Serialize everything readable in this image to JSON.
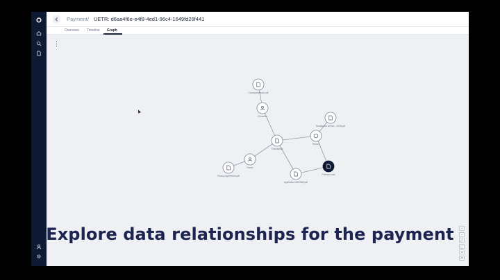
{
  "sidebar": {
    "items": [
      {
        "icon": "logo-icon"
      },
      {
        "icon": "home-icon"
      },
      {
        "icon": "search-icon"
      },
      {
        "icon": "document-icon"
      }
    ],
    "bottom_items": [
      {
        "icon": "user-icon"
      },
      {
        "icon": "gear-icon"
      }
    ]
  },
  "header": {
    "back_icon": "chevron-left-icon",
    "breadcrumb_parent": "Payment",
    "breadcrumb_separator": "/",
    "breadcrumb_current": "UETR: d6aa4f6e-e4f8-4ed1-96c4-1649fd26f441"
  },
  "tabs": [
    {
      "label": "Overview",
      "active": false
    },
    {
      "label": "Timeline",
      "active": false
    },
    {
      "label": "Graph",
      "active": true
    }
  ],
  "toolbar": {
    "more_icon": "⋮"
  },
  "graph": {
    "nodes": [
      {
        "id": "n1",
        "type": "document",
        "label": "Correspondence.pdf",
        "dark": false
      },
      {
        "id": "n2",
        "type": "person",
        "label": "Customer",
        "dark": false
      },
      {
        "id": "n3",
        "type": "document",
        "label": "Remittance advice – 2018.pdf",
        "dark": false
      },
      {
        "id": "n4",
        "type": "package",
        "label": "Record",
        "dark": false
      },
      {
        "id": "n5",
        "type": "document",
        "label": "Transaction",
        "dark": false
      },
      {
        "id": "n6",
        "type": "person",
        "label": "Owner",
        "dark": false
      },
      {
        "id": "n7",
        "type": "document",
        "label": "Privacy Agreement.pdf",
        "dark": false
      },
      {
        "id": "n8",
        "type": "document",
        "label": "Application 2827883.pdf",
        "dark": false
      },
      {
        "id": "n9",
        "type": "document",
        "label": "Primary node",
        "dark": true
      }
    ],
    "edges": [
      [
        "n1",
        "n2"
      ],
      [
        "n2",
        "n5"
      ],
      [
        "n5",
        "n6"
      ],
      [
        "n6",
        "n7"
      ],
      [
        "n5",
        "n4"
      ],
      [
        "n4",
        "n3"
      ],
      [
        "n5",
        "n8"
      ],
      [
        "n4",
        "n9"
      ],
      [
        "n8",
        "n9"
      ]
    ]
  },
  "zoom_controls": [
    "+",
    "−",
    "⤢",
    "□",
    "↺",
    "⊡"
  ],
  "caption": "Explore data relationships for the payment",
  "colors": {
    "sidebar_bg": "#0e1a33",
    "canvas_bg": "#eef0f4",
    "caption_text": "#1d2450",
    "node_dark": "#0e1a33"
  }
}
